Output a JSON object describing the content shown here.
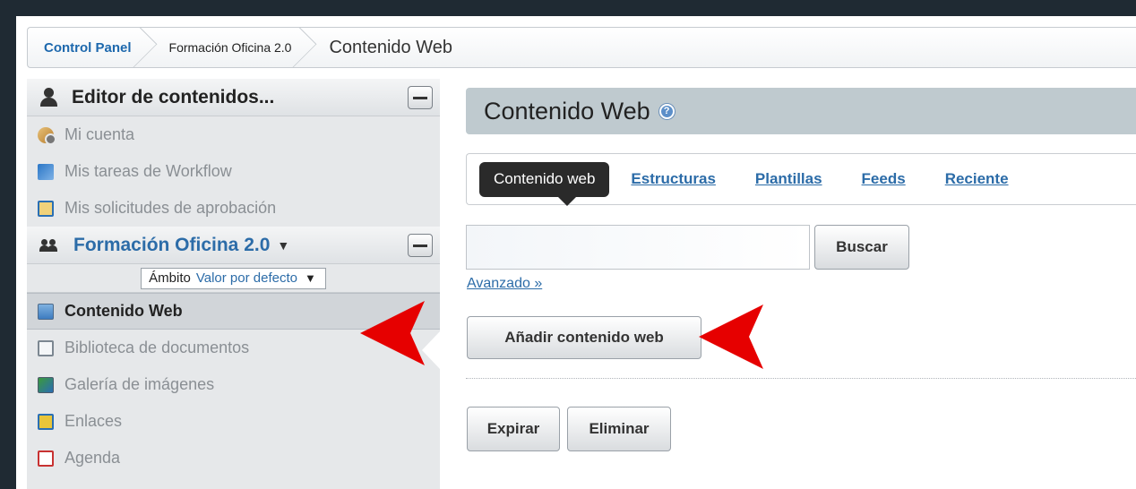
{
  "breadcrumb": {
    "control_panel": "Control Panel",
    "site": "Formación Oficina 2.0",
    "current": "Contenido Web"
  },
  "sidebar": {
    "editor_title": "Editor de contenidos...",
    "account_items": [
      {
        "label": "Mi cuenta",
        "icon": "user-gear-icon"
      },
      {
        "label": "Mis tareas de Workflow",
        "icon": "workflow-tasks-icon"
      },
      {
        "label": "Mis solicitudes de aprobación",
        "icon": "approval-requests-icon"
      }
    ],
    "group_title": "Formación Oficina 2.0",
    "group_caret": "▼",
    "scope": {
      "label": "Ámbito",
      "value": "Valor por defecto",
      "caret": "▼"
    },
    "content_items": [
      {
        "label": "Contenido Web",
        "icon": "web-content-icon",
        "selected": true
      },
      {
        "label": "Biblioteca de documentos",
        "icon": "document-library-icon"
      },
      {
        "label": "Galería de imágenes",
        "icon": "image-gallery-icon"
      },
      {
        "label": "Enlaces",
        "icon": "bookmarks-icon"
      },
      {
        "label": "Agenda",
        "icon": "calendar-icon"
      }
    ]
  },
  "main": {
    "title": "Contenido Web",
    "help_icon": "?",
    "tabs": [
      {
        "label": "Contenido web",
        "active": true
      },
      {
        "label": "Estructuras"
      },
      {
        "label": "Plantillas"
      },
      {
        "label": "Feeds"
      },
      {
        "label": "Reciente"
      }
    ],
    "search": {
      "value": "",
      "placeholder": "",
      "button_label": "Buscar",
      "advanced_label": "Avanzado »"
    },
    "add_button_label": "Añadir contenido web",
    "expire_button_label": "Expirar",
    "delete_button_label": "Eliminar"
  },
  "colors": {
    "accent": "#2c6ca8",
    "annotation_arrow": "#e60000",
    "header_bg": "#bfcacf"
  }
}
